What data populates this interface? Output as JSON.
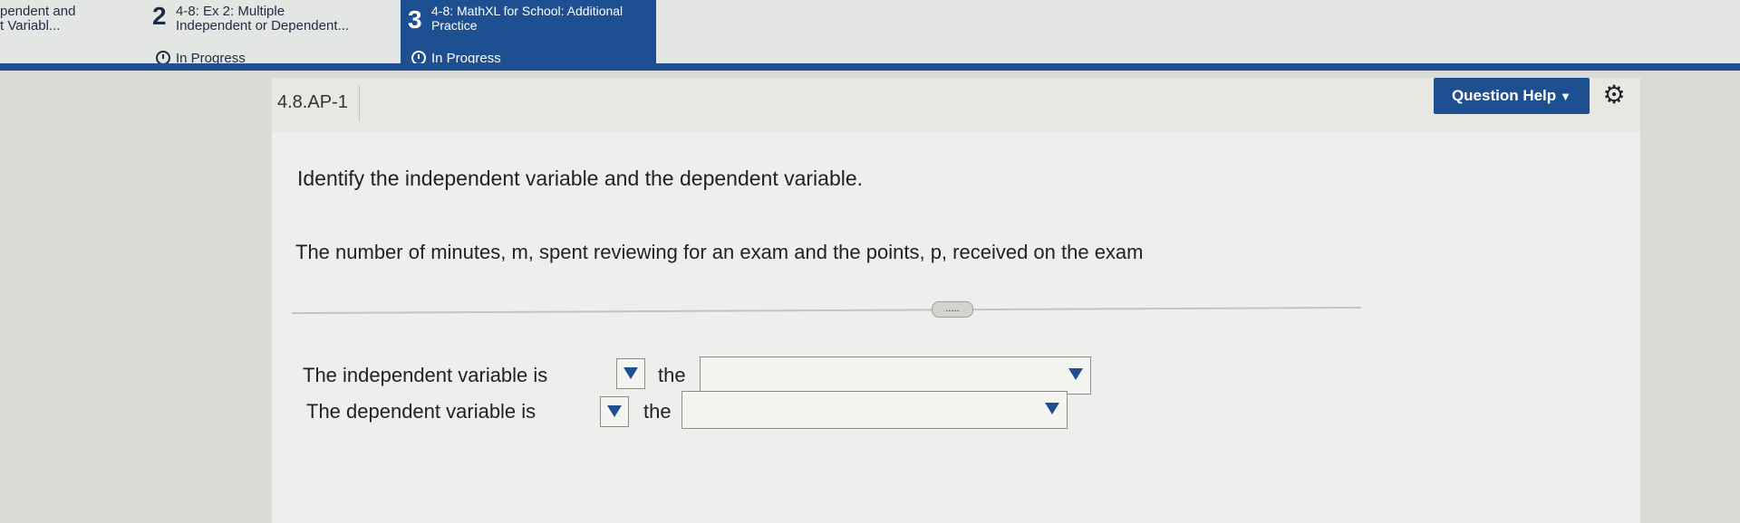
{
  "assignments": [
    {
      "number": "",
      "line1": "pendent and",
      "line2": "t Variabl...",
      "status": "In Progress"
    },
    {
      "number": "2",
      "line1": "4-8: Ex 2: Multiple",
      "line2": "Independent or Dependent...",
      "status": "In Progress"
    },
    {
      "number": "3",
      "line1": "4-8: MathXL for School: Additional",
      "line2": "Practice",
      "status": "In Progress"
    }
  ],
  "question": {
    "id": "4.8.AP-1",
    "help_label": "Question Help",
    "instruction": "Identify the independent variable and the dependent variable.",
    "prompt": "The number of minutes, m, spent reviewing for an exam and the points, p, received on the exam",
    "more_label": "....."
  },
  "answers": [
    {
      "label": "The independent variable is",
      "connector": "the"
    },
    {
      "label": "The dependent variable is",
      "connector": "the"
    }
  ],
  "colors": {
    "accent": "#1d4f91"
  }
}
